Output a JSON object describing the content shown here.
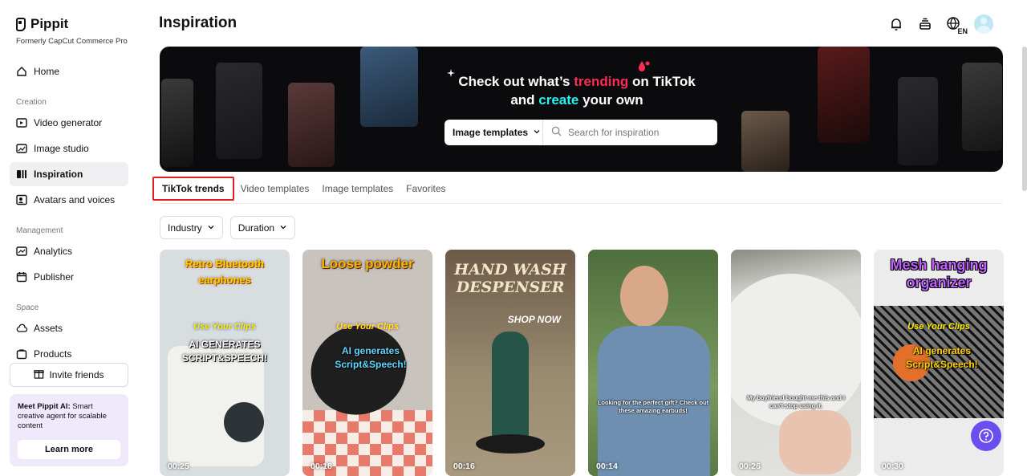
{
  "brand": {
    "name": "Pippit",
    "subtitle": "Formerly CapCut Commerce Pro"
  },
  "sidebar": {
    "home": "Home",
    "creation_label": "Creation",
    "creation": [
      {
        "label": "Video generator",
        "icon": "video-plus-icon"
      },
      {
        "label": "Image studio",
        "icon": "image-plus-icon"
      },
      {
        "label": "Inspiration",
        "icon": "inspiration-icon",
        "active": true
      },
      {
        "label": "Avatars and voices",
        "icon": "avatar-voice-icon"
      }
    ],
    "management_label": "Management",
    "management": [
      {
        "label": "Analytics",
        "icon": "analytics-icon"
      },
      {
        "label": "Publisher",
        "icon": "calendar-icon"
      }
    ],
    "space_label": "Space",
    "space": [
      {
        "label": "Assets",
        "icon": "cloud-icon"
      },
      {
        "label": "Products",
        "icon": "bag-icon"
      }
    ],
    "invite": "Invite friends",
    "promo": {
      "title": "Meet Pippit AI:",
      "text": " Smart creative agent for scalable content",
      "button": "Learn more"
    }
  },
  "header": {
    "title": "Inspiration",
    "lang": "EN"
  },
  "banner": {
    "line1_pre": "Check out what’s ",
    "line1_hl": "trending",
    "line1_post": " on TikTok",
    "line2_pre": "and ",
    "line2_hl": "create",
    "line2_post": " your own",
    "search_type": "Image templates",
    "search_placeholder": "Search for inspiration",
    "accent_pink": "#fe2c55",
    "accent_cyan": "#25f4ee"
  },
  "tabs": [
    "TikTok trends",
    "Video templates",
    "Image templates",
    "Favorites"
  ],
  "filters": [
    "Industry",
    "Duration"
  ],
  "cards": [
    {
      "caption": "Retro Bluetooth earphones",
      "sub": "Use Your Clips",
      "sub2": "AI GENERATES SCRIPT&SPEECH!",
      "duration": "00:25",
      "bg": "#d8dde0"
    },
    {
      "caption": "Loose powder",
      "sub": "Use Your Clips",
      "sub2": "AI generates Script&Speech!",
      "duration": "00:18",
      "bg": "#c9c3bd"
    },
    {
      "caption": "HAND WASH DESPENSER",
      "sub": "SHOP NOW",
      "sub2": "",
      "duration": "00:16",
      "bg": "#8a8174"
    },
    {
      "caption": "",
      "sub": "Looking for the perfect gift? Check out these amazing earbuds!",
      "sub2": "",
      "duration": "00:14",
      "bg": "#6e8a5a"
    },
    {
      "caption": "",
      "sub": "My boyfriend bought me this and I can't stop using it.",
      "sub2": "",
      "duration": "00:26",
      "bg": "#d9d9d6"
    },
    {
      "caption": "Mesh hanging organizer",
      "sub": "Use Your Clips",
      "sub2": "AI generates Script&Speech!",
      "duration": "00:30",
      "bg": "#ececec"
    }
  ]
}
